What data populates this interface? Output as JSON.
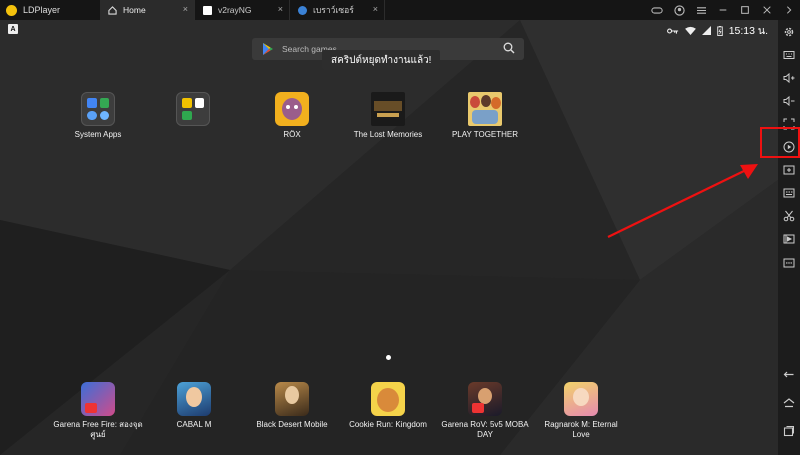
{
  "titlebar": {
    "app_name": "LDPlayer",
    "tabs": [
      {
        "label": "Home",
        "active": true
      },
      {
        "label": "v2rayNG",
        "active": false
      },
      {
        "label": "เบราว์เซอร์",
        "active": false
      }
    ],
    "close_glyph": "×"
  },
  "statusbar": {
    "left_badge": "A",
    "time": "15:13 น."
  },
  "search": {
    "placeholder": "Search games"
  },
  "toast": {
    "text": "สคริปต์หยุดทำงานแล้ว!"
  },
  "desktop_apps": [
    {
      "label": "System Apps"
    },
    {
      "label": ""
    },
    {
      "label": "RÖX"
    },
    {
      "label": "The Lost Memories"
    },
    {
      "label": "PLAY TOGETHER"
    }
  ],
  "dock_apps": [
    {
      "label": "Garena Free Fire: สองจุด ศูนย์"
    },
    {
      "label": "CABAL M"
    },
    {
      "label": "Black Desert Mobile"
    },
    {
      "label": "Cookie Run: Kingdom"
    },
    {
      "label": "Garena RoV: 5v5 MOBA DAY"
    },
    {
      "label": "Ragnarok M: Eternal Love"
    }
  ],
  "sidebar": {
    "buttons": [
      "settings-icon",
      "keyboard-icon",
      "volume-up-icon",
      "volume-down-icon",
      "fullscreen-icon",
      "record-icon",
      "screenshot-icon",
      "multi-instance-icon",
      "scissors-icon",
      "video-icon",
      "more-icon",
      "back-icon",
      "home-icon",
      "recent-apps-icon"
    ]
  },
  "colors": {
    "highlight": "#e11111",
    "accent": "#f4c20d"
  }
}
